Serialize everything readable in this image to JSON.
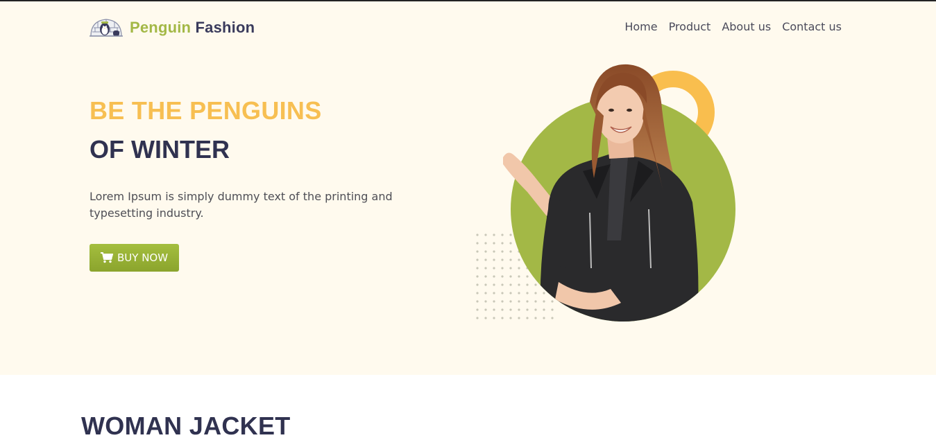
{
  "brand": {
    "name_part1": "Penguin",
    "name_part2": "Fashion",
    "logo_icon": "penguin-igloo-icon",
    "colors": {
      "green": "#a3b846",
      "navy": "#3a3b5c"
    }
  },
  "nav": {
    "items": [
      {
        "label": "Home"
      },
      {
        "label": "Product"
      },
      {
        "label": "About us"
      },
      {
        "label": "Contact us"
      }
    ]
  },
  "hero": {
    "title_line1": "BE THE PENGUINS",
    "title_line2": "OF WINTER",
    "description": "Lorem Ipsum is simply dummy text of the printing and typesetting industry.",
    "cta_label": "BUY NOW",
    "cta_icon": "shopping-cart-icon",
    "image_alt": "smiling woman in black leather jacket",
    "colors": {
      "background": "#fffaee",
      "accent_yellow": "#f7bf52",
      "accent_green": "#a3b846",
      "title_navy": "#303250"
    }
  },
  "section": {
    "title": "WOMAN JACKET"
  }
}
